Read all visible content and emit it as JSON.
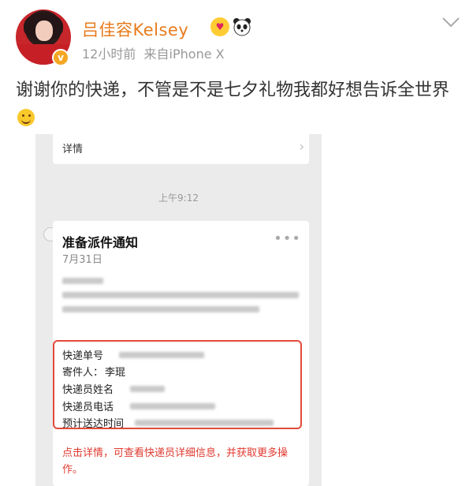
{
  "user": {
    "name": "吕佳容Kelsey",
    "time": "12小时前",
    "source": "来自iPhone X",
    "verified_badge": "v",
    "badges": [
      "heart-eyes-emoji-icon",
      "panda-emoji-icon"
    ]
  },
  "post": {
    "text": "谢谢你的快递，不管是不是七夕礼物我都好想告诉全世界",
    "emoji": "smile-emoji-icon"
  },
  "screenshot": {
    "top_card_label": "详情",
    "chat_time": "上午9:12",
    "card": {
      "title": "准备派件通知",
      "date": "7月31日",
      "fields": [
        {
          "label": "快递单号",
          "value": ""
        },
        {
          "label": "寄件人：",
          "value": "李琨"
        },
        {
          "label": "快递员姓名",
          "value": ""
        },
        {
          "label": "快递员电话",
          "value": ""
        },
        {
          "label": "预计送达时间",
          "value": ""
        }
      ],
      "note": "点击详情，可查看快递员详细信息，并获取更多操作。"
    }
  },
  "colors": {
    "username": "#e87b1c",
    "highlight_border": "#e24a3a",
    "note_text": "#e03a2f"
  }
}
